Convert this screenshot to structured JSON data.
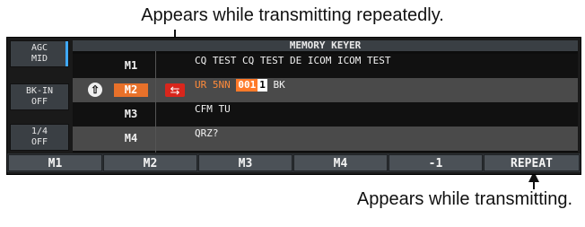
{
  "annotations": {
    "top": "Appears while transmitting repeatedly.",
    "bottom": "Appears while transmitting."
  },
  "side_buttons": [
    {
      "line1": "AGC",
      "line2": "MID"
    },
    {
      "line1": "BK-IN",
      "line2": "OFF"
    },
    {
      "line1": "1/4",
      "line2": "OFF"
    }
  ],
  "panel": {
    "title": "MEMORY KEYER",
    "rows": [
      {
        "key": "M1",
        "message": "CQ TEST CQ TEST DE ICOM ICOM TEST"
      },
      {
        "key": "M2",
        "message_prefix": "UR 5NN",
        "chip1": "001",
        "chip2": "1",
        "message_suffix": " BK"
      },
      {
        "key": "M3",
        "message": "CFM TU"
      },
      {
        "key": "M4",
        "message": "QRZ?"
      }
    ]
  },
  "function_keys": [
    "M1",
    "M2",
    "M3",
    "M4",
    "-1",
    "REPEAT"
  ],
  "icons": {
    "transmitting": "up-arrow-icon",
    "repeat": "repeat-icon"
  },
  "colors": {
    "selected_key": "#e8712a",
    "repeat_icon": "#d9261c",
    "active_side": "#3fa9ff"
  }
}
